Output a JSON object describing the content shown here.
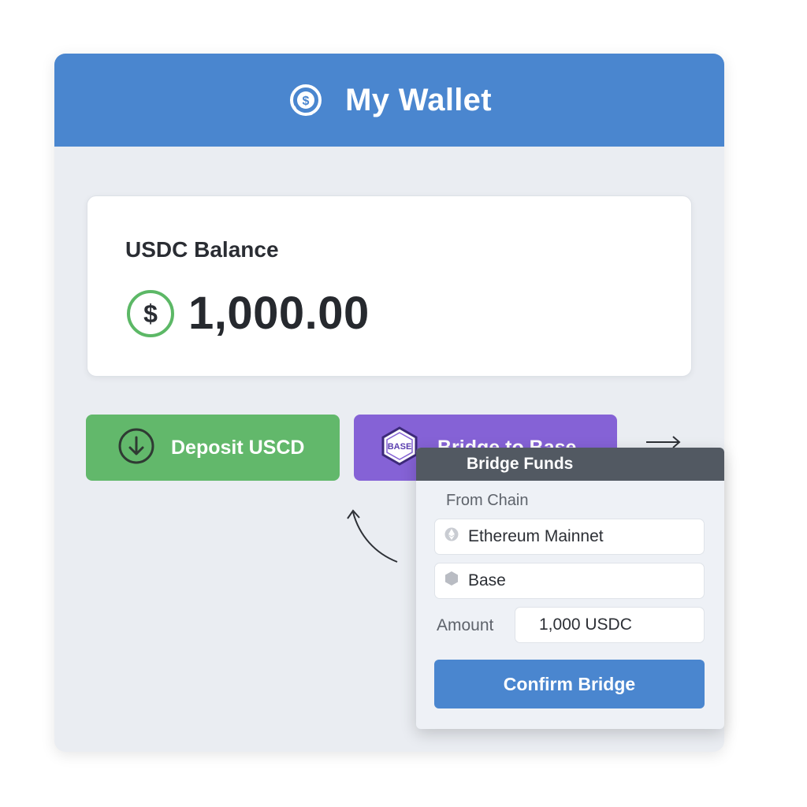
{
  "header": {
    "title": "My Wallet",
    "icon": "coin-icon"
  },
  "balance": {
    "label": "USDC Balance",
    "amount": "1,000.00",
    "icon": "dollar-icon"
  },
  "actions": {
    "deposit_label": "Deposit USCD",
    "bridge_label": "Bridge to Base",
    "base_badge": "BASE"
  },
  "bridge_popup": {
    "title": "Bridge Funds",
    "from_label": "From Chain",
    "from_value": "Ethereum Mainnet",
    "to_value": "Base",
    "amount_label": "Amount",
    "amount_value": "1,000 USDC",
    "confirm_label": "Confirm Bridge"
  },
  "colors": {
    "header": "#4a86cf",
    "deposit": "#62b86b",
    "bridge": "#8562d6",
    "confirm": "#4a86cf",
    "popup_header": "#525962"
  }
}
